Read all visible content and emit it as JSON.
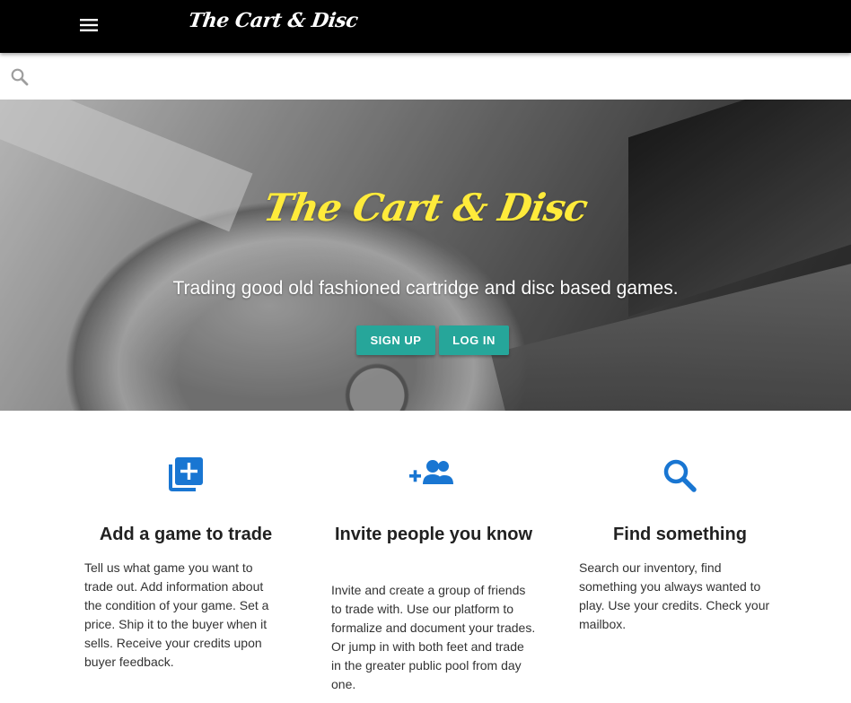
{
  "nav": {
    "menu_icon": "menu-icon",
    "brand": "The Cart & Disc"
  },
  "search": {
    "icon": "search-icon",
    "placeholder": "",
    "value": ""
  },
  "hero": {
    "title": "The Cart & Disc",
    "tagline": "Trading good old fashioned cartridge and disc based games.",
    "signup_label": "SIGN UP",
    "login_label": "LOG IN"
  },
  "features": [
    {
      "icon": "add-box-icon",
      "title": "Add a game to trade",
      "text": "Tell us what game you want to trade out. Add information about the condition of your game. Set a price. Ship it to the buyer when it sells. Receive your credits upon buyer feedback."
    },
    {
      "icon": "group-add-icon",
      "title": "Invite people you know",
      "text": "Invite and create a group of friends to trade with. Use our platform to formalize and document your trades. Or jump in with both feet and trade in the greater public pool from day one."
    },
    {
      "icon": "search-icon",
      "title": "Find something",
      "text": "Search our inventory, find something you always wanted to play. Use your credits. Check your mailbox."
    }
  ],
  "colors": {
    "accent": "#1976d2",
    "button": "#26a69a",
    "hero_title": "#ffeb3b",
    "topbar": "#000000"
  }
}
